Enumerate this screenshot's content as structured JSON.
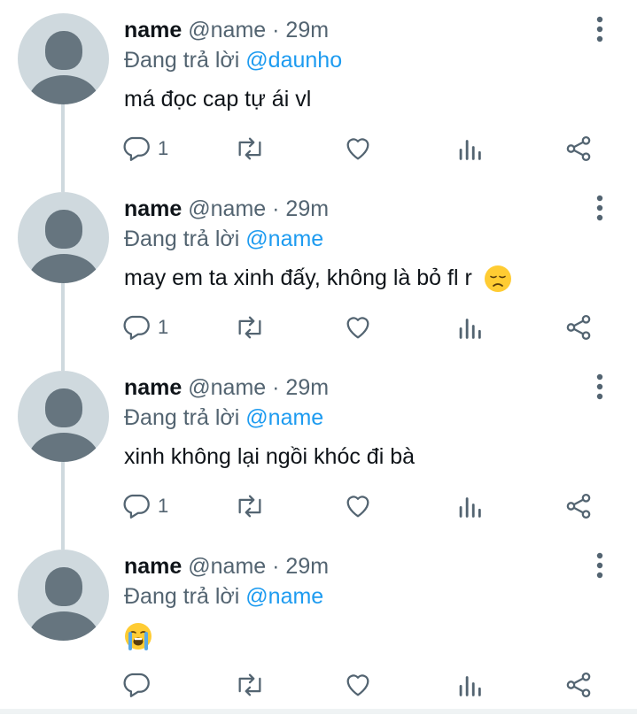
{
  "tweets": [
    {
      "name": "name",
      "handle": "@name",
      "dot": "·",
      "time": "29m",
      "reply_prefix": "Đang trả lời",
      "reply_to": "@daunho",
      "text": "má đọc cap tự ái vl",
      "emoji": "",
      "reply_count": "1"
    },
    {
      "name": "name",
      "handle": "@name",
      "dot": "·",
      "time": "29m",
      "reply_prefix": "Đang trả lời",
      "reply_to": "@name",
      "text": "may em ta xinh đấy, không là bỏ fl r",
      "emoji": "disappointed-face-emoji",
      "reply_count": "1"
    },
    {
      "name": "name",
      "handle": "@name",
      "dot": "·",
      "time": "29m",
      "reply_prefix": "Đang trả lời",
      "reply_to": "@name",
      "text": "xinh không lại ngồi khóc đi bà",
      "emoji": "",
      "reply_count": "1"
    },
    {
      "name": "name",
      "handle": "@name",
      "dot": "·",
      "time": "29m",
      "reply_prefix": "Đang trả lời",
      "reply_to": "@name",
      "text": "",
      "emoji": "loudly-crying-face-emoji",
      "reply_count": ""
    }
  ],
  "icons": {
    "reply": "reply-icon",
    "retweet": "retweet-icon",
    "like": "heart-icon",
    "analytics": "analytics-icon",
    "share": "share-icon",
    "more": "more-vertical-icon"
  },
  "colors": {
    "text": "#0f1419",
    "secondary": "#536471",
    "mention": "#1d9bf0",
    "avatar_bg": "#cfd9de",
    "avatar_fg": "#66757f",
    "thread_line": "#cfd9de",
    "emoji_yellow": "#ffcc33"
  }
}
